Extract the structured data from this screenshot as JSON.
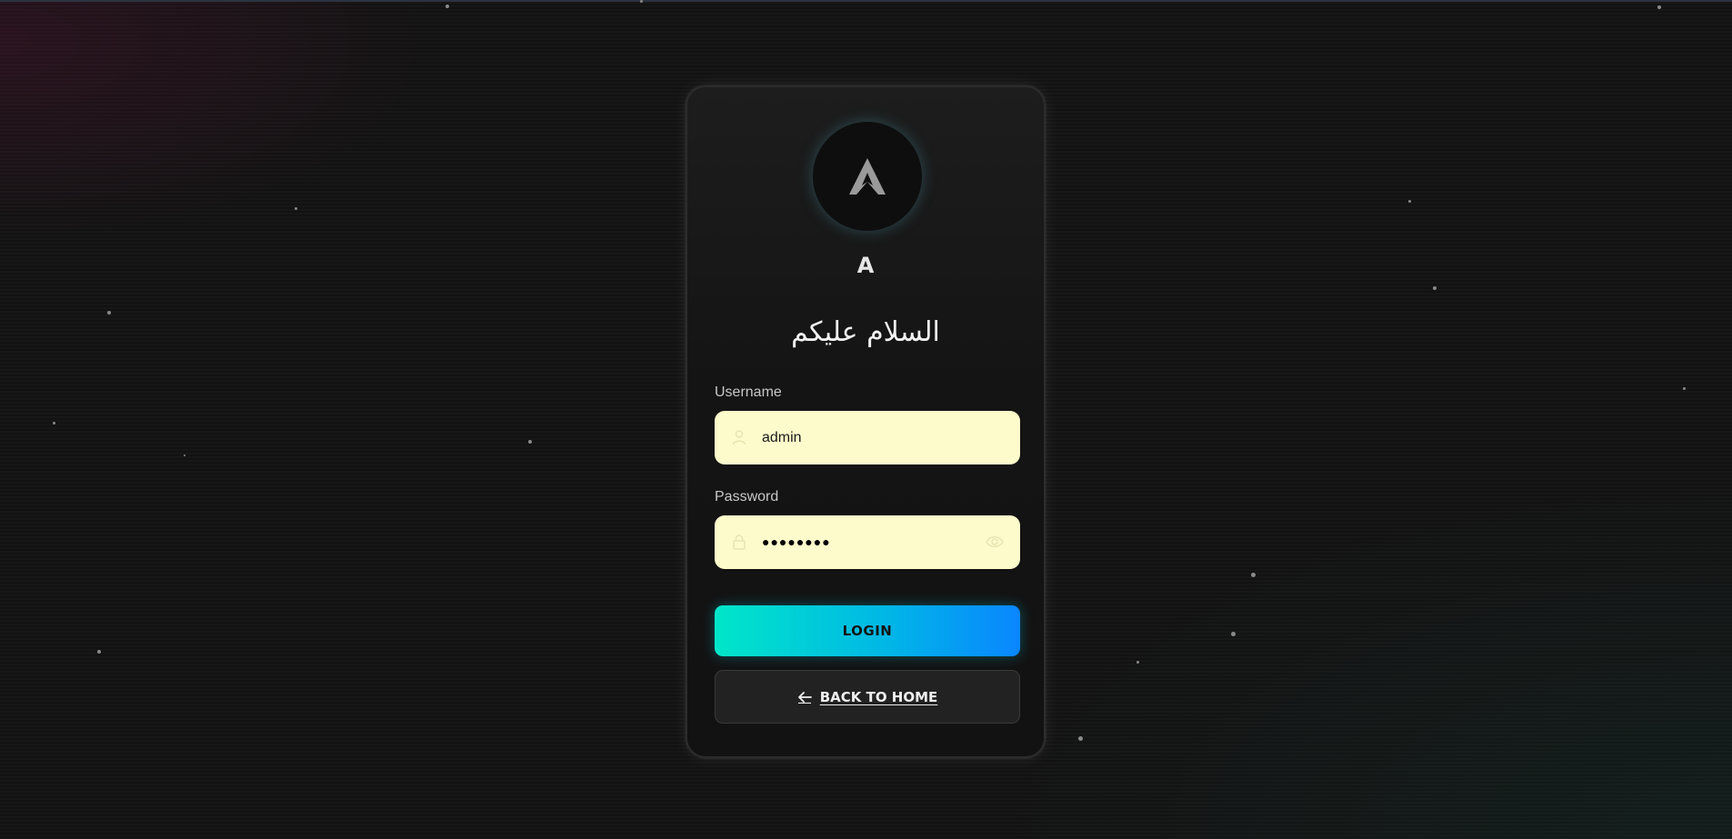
{
  "brand": {
    "name": "A"
  },
  "greeting": "السلام عليكم",
  "form": {
    "username": {
      "label": "Username",
      "value": "admin",
      "icon": "user-icon"
    },
    "password": {
      "label": "Password",
      "value": "●●●●●●●●",
      "icon": "lock-icon",
      "toggle_icon": "eye-icon"
    },
    "login_label": "LOGIN",
    "back_label": "BACK TO HOME",
    "back_icon": "arrow-left-icon"
  },
  "colors": {
    "background": "#121212",
    "card": "#181818",
    "input_background": "#fdfbcb",
    "login_gradient_start": "#00e6c8",
    "login_gradient_end": "#0a86ff",
    "accent_glow": "#50aabe"
  }
}
